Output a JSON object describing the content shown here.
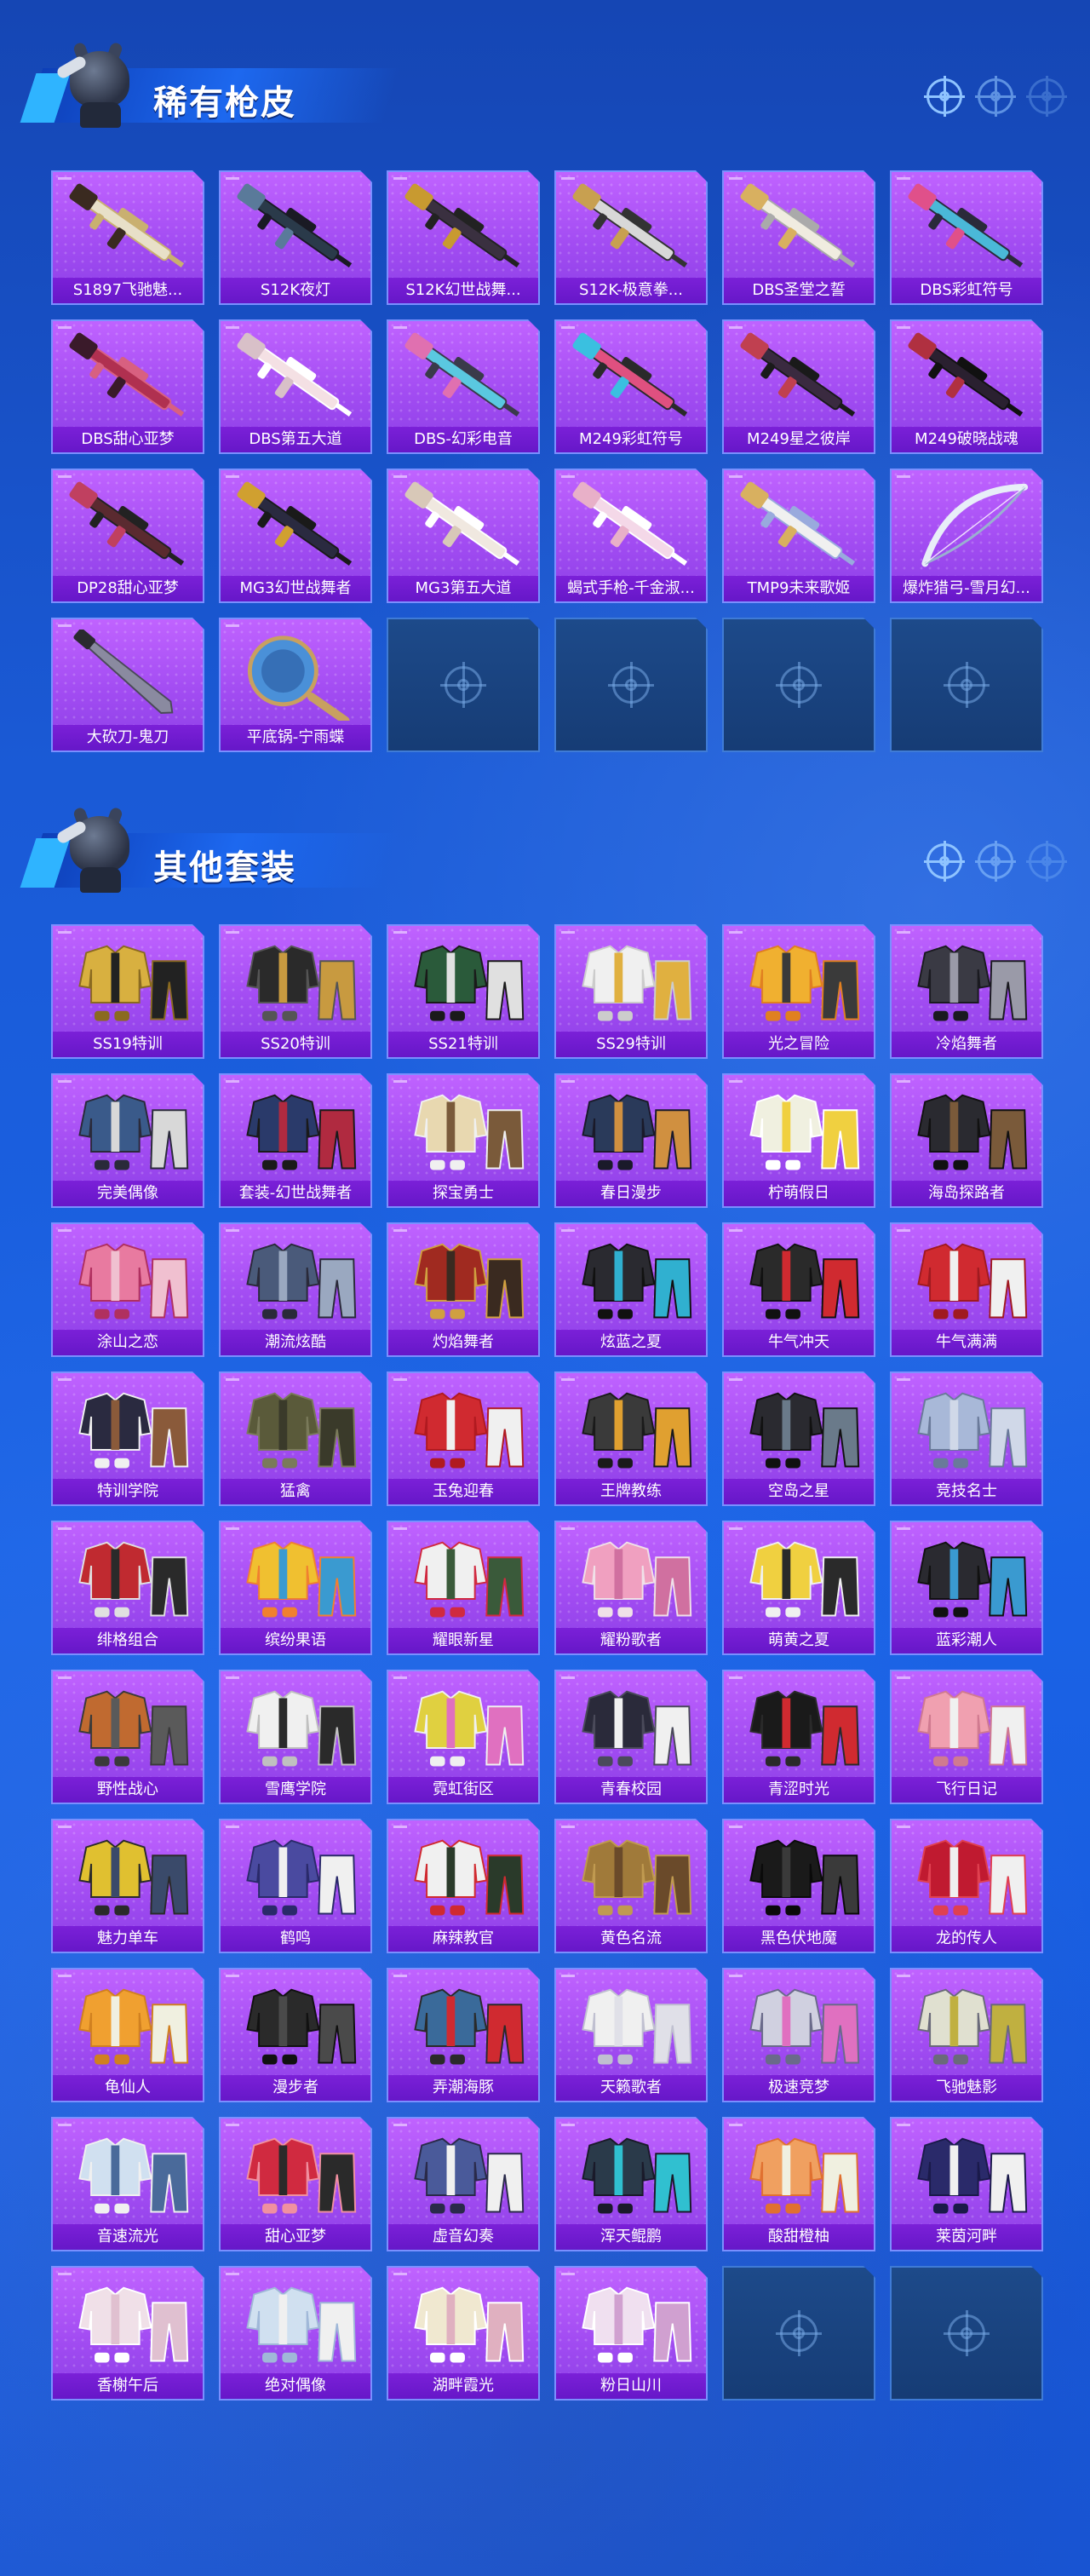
{
  "sections": [
    {
      "title": "稀有枪皮",
      "items": [
        {
          "label": "S1897飞驰魅...",
          "kind": "gun",
          "colors": [
            "#e8e0c8",
            "#3a2a20",
            "#c9b070"
          ]
        },
        {
          "label": "S12K夜灯",
          "kind": "gun",
          "colors": [
            "#2a3a4a",
            "#5a7a9a",
            "#1a1a24"
          ]
        },
        {
          "label": "S12K幻世战舞...",
          "kind": "gun",
          "colors": [
            "#3a3040",
            "#c89a30",
            "#222"
          ]
        },
        {
          "label": "S12K-极意拳...",
          "kind": "gun",
          "colors": [
            "#d8d8d8",
            "#c8a050",
            "#333"
          ]
        },
        {
          "label": "DBS圣堂之誓",
          "kind": "gun",
          "colors": [
            "#f0ece0",
            "#d8b060",
            "#aaa"
          ]
        },
        {
          "label": "DBS彩虹符号",
          "kind": "gun",
          "colors": [
            "#4ab8d8",
            "#e0508a",
            "#2a2a3a"
          ]
        },
        {
          "label": "DBS甜心亚梦",
          "kind": "gun",
          "colors": [
            "#b03050",
            "#3a1a2a",
            "#d86080"
          ]
        },
        {
          "label": "DBS第五大道",
          "kind": "gun",
          "colors": [
            "#f4e0e4",
            "#d8c0c8",
            "#fff"
          ]
        },
        {
          "label": "DBS-幻彩电音",
          "kind": "gun",
          "colors": [
            "#5ac8e0",
            "#e070b0",
            "#3a3a4a"
          ]
        },
        {
          "label": "M249彩虹符号",
          "kind": "gun",
          "colors": [
            "#e05080",
            "#3ac0e0",
            "#2a2a2a"
          ]
        },
        {
          "label": "M249星之彼岸",
          "kind": "gun",
          "colors": [
            "#3a2a40",
            "#c04050",
            "#1a1a1a"
          ]
        },
        {
          "label": "M249破晓战魂",
          "kind": "gun",
          "colors": [
            "#2a2030",
            "#b03040",
            "#111"
          ]
        },
        {
          "label": "DP28甜心亚梦",
          "kind": "gun",
          "colors": [
            "#5a2a30",
            "#c04060",
            "#222"
          ]
        },
        {
          "label": "MG3幻世战舞者",
          "kind": "gun",
          "colors": [
            "#2a2a40",
            "#d0a030",
            "#1a1a1a"
          ]
        },
        {
          "label": "MG3第五大道",
          "kind": "gun",
          "colors": [
            "#f0e8e0",
            "#d8c8b8",
            "#fff"
          ]
        },
        {
          "label": "蝎式手枪-千金淑...",
          "kind": "gun",
          "colors": [
            "#f4d8e8",
            "#e8b0c8",
            "#fff"
          ]
        },
        {
          "label": "TMP9未来歌姬",
          "kind": "gun",
          "colors": [
            "#f0f0f0",
            "#d8b060",
            "#9ad"
          ]
        },
        {
          "label": "爆炸猎弓-雪月幻...",
          "kind": "bow",
          "colors": [
            "#e8eef8",
            "#9ab0d0",
            "#fff"
          ]
        },
        {
          "label": "大砍刀-鬼刀",
          "kind": "blade",
          "colors": [
            "#4a4a58",
            "#8a8aa0",
            "#2a2a30"
          ]
        },
        {
          "label": "平底锅-宁雨蝶",
          "kind": "pan",
          "colors": [
            "#4a90d8",
            "#c8a060",
            "#2a5aa0"
          ]
        },
        {
          "label": "",
          "kind": "empty"
        },
        {
          "label": "",
          "kind": "empty"
        },
        {
          "label": "",
          "kind": "empty"
        },
        {
          "label": "",
          "kind": "empty"
        }
      ]
    },
    {
      "title": "其他套装",
      "items": [
        {
          "label": "SS19特训",
          "kind": "outfit",
          "colors": [
            "#d8b040",
            "#222",
            "#8a6a20"
          ]
        },
        {
          "label": "SS20特训",
          "kind": "outfit",
          "colors": [
            "#2a2a2a",
            "#c89a40",
            "#555"
          ]
        },
        {
          "label": "SS21特训",
          "kind": "outfit",
          "colors": [
            "#2a5a3a",
            "#e0e0e0",
            "#1a1a1a"
          ]
        },
        {
          "label": "SS29特训",
          "kind": "outfit",
          "colors": [
            "#f0f0f0",
            "#e0b040",
            "#ccc"
          ]
        },
        {
          "label": "光之冒险",
          "kind": "outfit",
          "colors": [
            "#f0b030",
            "#3a3a3a",
            "#e08020"
          ]
        },
        {
          "label": "冷焰舞者",
          "kind": "outfit",
          "colors": [
            "#3a3a44",
            "#9a9aa8",
            "#1a1a20"
          ]
        },
        {
          "label": "完美偶像",
          "kind": "outfit",
          "colors": [
            "#3a5a8a",
            "#d8d8d8",
            "#2a2a3a"
          ]
        },
        {
          "label": "套装-幻世战舞者",
          "kind": "outfit",
          "colors": [
            "#2a3a6a",
            "#b02a40",
            "#1a1a1a"
          ]
        },
        {
          "label": "探宝勇士",
          "kind": "outfit",
          "colors": [
            "#e8d8b0",
            "#7a5a3a",
            "#f0f0f0"
          ]
        },
        {
          "label": "春日漫步",
          "kind": "outfit",
          "colors": [
            "#2a3a5a",
            "#d09040",
            "#1a1a2a"
          ]
        },
        {
          "label": "柠萌假日",
          "kind": "outfit",
          "colors": [
            "#f0f0e0",
            "#f0d040",
            "#fff"
          ]
        },
        {
          "label": "海岛探路者",
          "kind": "outfit",
          "colors": [
            "#2a2a30",
            "#7a5a3a",
            "#111"
          ]
        },
        {
          "label": "涂山之恋",
          "kind": "outfit",
          "colors": [
            "#e87aa0",
            "#f0c0d0",
            "#b03060"
          ]
        },
        {
          "label": "潮流炫酷",
          "kind": "outfit",
          "colors": [
            "#4a5a7a",
            "#9aa8c0",
            "#2a2a3a"
          ]
        },
        {
          "label": "灼焰舞者",
          "kind": "outfit",
          "colors": [
            "#a02a20",
            "#3a2a20",
            "#d0a040"
          ]
        },
        {
          "label": "炫蓝之夏",
          "kind": "outfit",
          "colors": [
            "#2a2a30",
            "#30b0d0",
            "#111"
          ]
        },
        {
          "label": "牛气冲天",
          "kind": "outfit",
          "colors": [
            "#2a2a2a",
            "#d02a30",
            "#111"
          ]
        },
        {
          "label": "牛气满满",
          "kind": "outfit",
          "colors": [
            "#d02a30",
            "#f0f0f0",
            "#a01a20"
          ]
        },
        {
          "label": "特训学院",
          "kind": "outfit",
          "colors": [
            "#2a2a40",
            "#8a5a3a",
            "#f0f0f0"
          ]
        },
        {
          "label": "猛禽",
          "kind": "outfit",
          "colors": [
            "#5a5a3a",
            "#3a3a2a",
            "#7a7a5a"
          ]
        },
        {
          "label": "玉兔迎春",
          "kind": "outfit",
          "colors": [
            "#d02a30",
            "#f0f0f0",
            "#b01a20"
          ]
        },
        {
          "label": "王牌教练",
          "kind": "outfit",
          "colors": [
            "#3a3a3a",
            "#e0a030",
            "#1a1a1a"
          ]
        },
        {
          "label": "空岛之星",
          "kind": "outfit",
          "colors": [
            "#2a2a30",
            "#6a7a8a",
            "#111"
          ]
        },
        {
          "label": "竞技名士",
          "kind": "outfit",
          "colors": [
            "#a8b8d8",
            "#d0d8e8",
            "#6a7a9a"
          ]
        },
        {
          "label": "绯格组合",
          "kind": "outfit",
          "colors": [
            "#c02a30",
            "#2a2a2a",
            "#e0e0e0"
          ]
        },
        {
          "label": "缤纷果语",
          "kind": "outfit",
          "colors": [
            "#f0c030",
            "#3a9ad0",
            "#f08030"
          ]
        },
        {
          "label": "耀眼新星",
          "kind": "outfit",
          "colors": [
            "#f0f0f0",
            "#3a5a3a",
            "#d02a40"
          ]
        },
        {
          "label": "耀粉歌者",
          "kind": "outfit",
          "colors": [
            "#f0a0c0",
            "#d070a0",
            "#f0e0e8"
          ]
        },
        {
          "label": "萌黄之夏",
          "kind": "outfit",
          "colors": [
            "#f0d040",
            "#2a2a2a",
            "#f0f0f0"
          ]
        },
        {
          "label": "蓝彩潮人",
          "kind": "outfit",
          "colors": [
            "#2a2a30",
            "#3a9ad0",
            "#111"
          ]
        },
        {
          "label": "野性战心",
          "kind": "outfit",
          "colors": [
            "#c06a30",
            "#5a5a5a",
            "#3a3a3a"
          ]
        },
        {
          "label": "雪鹰学院",
          "kind": "outfit",
          "colors": [
            "#f0f0f0",
            "#2a2a2a",
            "#c0c0c0"
          ]
        },
        {
          "label": "霓虹街区",
          "kind": "outfit",
          "colors": [
            "#e0d040",
            "#e070c0",
            "#f0f0f0"
          ]
        },
        {
          "label": "青春校园",
          "kind": "outfit",
          "colors": [
            "#2a2a3a",
            "#f0f0f0",
            "#4a4a5a"
          ]
        },
        {
          "label": "青涩时光",
          "kind": "outfit",
          "colors": [
            "#1a1a1a",
            "#d02a30",
            "#2a2a2a"
          ]
        },
        {
          "label": "飞行日记",
          "kind": "outfit",
          "colors": [
            "#f0a0b0",
            "#f0f0f0",
            "#d07a90"
          ]
        },
        {
          "label": "魅力单车",
          "kind": "outfit",
          "colors": [
            "#e0c030",
            "#3a4a6a",
            "#2a2a2a"
          ]
        },
        {
          "label": "鹤鸣",
          "kind": "outfit",
          "colors": [
            "#4a4aa0",
            "#f0f0f0",
            "#2a2a6a"
          ]
        },
        {
          "label": "麻辣教官",
          "kind": "outfit",
          "colors": [
            "#f0f0f0",
            "#2a3a2a",
            "#d02a30"
          ]
        },
        {
          "label": "黄色名流",
          "kind": "outfit",
          "colors": [
            "#a07a3a",
            "#6a4a2a",
            "#c09a50"
          ]
        },
        {
          "label": "黑色伏地魔",
          "kind": "outfit",
          "colors": [
            "#1a1a1a",
            "#3a3a3a",
            "#0a0a0a"
          ]
        },
        {
          "label": "龙的传人",
          "kind": "outfit",
          "colors": [
            "#c01a30",
            "#f0f0f0",
            "#e04050"
          ]
        },
        {
          "label": "龟仙人",
          "kind": "outfit",
          "colors": [
            "#f0a030",
            "#f0f0e0",
            "#d08020"
          ]
        },
        {
          "label": "漫步者",
          "kind": "outfit",
          "colors": [
            "#2a2a2a",
            "#4a4a4a",
            "#111"
          ]
        },
        {
          "label": "弄潮海豚",
          "kind": "outfit",
          "colors": [
            "#3a6a9a",
            "#d02a30",
            "#2a2a2a"
          ]
        },
        {
          "label": "天籁歌者",
          "kind": "outfit",
          "colors": [
            "#f0f0f0",
            "#e0e0e8",
            "#c0c0d0"
          ]
        },
        {
          "label": "极速竞梦",
          "kind": "outfit",
          "colors": [
            "#d0d0e0",
            "#e070c0",
            "#6a6a8a"
          ]
        },
        {
          "label": "飞驰魅影",
          "kind": "outfit",
          "colors": [
            "#e0e0d0",
            "#c0b040",
            "#6a6a7a"
          ]
        },
        {
          "label": "音速流光",
          "kind": "outfit",
          "colors": [
            "#d0e0f0",
            "#4a6a9a",
            "#f0f0f0"
          ]
        },
        {
          "label": "甜心亚梦",
          "kind": "outfit",
          "colors": [
            "#d02a40",
            "#2a2a2a",
            "#f090a0"
          ]
        },
        {
          "label": "虚音幻奏",
          "kind": "outfit",
          "colors": [
            "#4a5a9a",
            "#f0f0f0",
            "#2a2a4a"
          ]
        },
        {
          "label": "浑天鲲鹏",
          "kind": "outfit",
          "colors": [
            "#2a3a4a",
            "#30c0d0",
            "#1a1a2a"
          ]
        },
        {
          "label": "酸甜橙柚",
          "kind": "outfit",
          "colors": [
            "#f0a060",
            "#f0f0e0",
            "#e07030"
          ]
        },
        {
          "label": "莱茵河畔",
          "kind": "outfit",
          "colors": [
            "#2a2a6a",
            "#f0f0f0",
            "#1a1a4a"
          ]
        },
        {
          "label": "香榭午后",
          "kind": "outfit",
          "colors": [
            "#f0e0e8",
            "#e0c0d0",
            "#fff"
          ]
        },
        {
          "label": "绝对偶像",
          "kind": "outfit",
          "colors": [
            "#d0e0f0",
            "#f0f0f0",
            "#a0b8d8"
          ]
        },
        {
          "label": "湖畔霞光",
          "kind": "outfit",
          "colors": [
            "#f0e8d0",
            "#e0b0c0",
            "#fff"
          ]
        },
        {
          "label": "粉日山川",
          "kind": "outfit",
          "colors": [
            "#f0e0f0",
            "#d0a0d0",
            "#fff"
          ]
        },
        {
          "label": "",
          "kind": "empty"
        },
        {
          "label": "",
          "kind": "empty"
        }
      ]
    }
  ]
}
